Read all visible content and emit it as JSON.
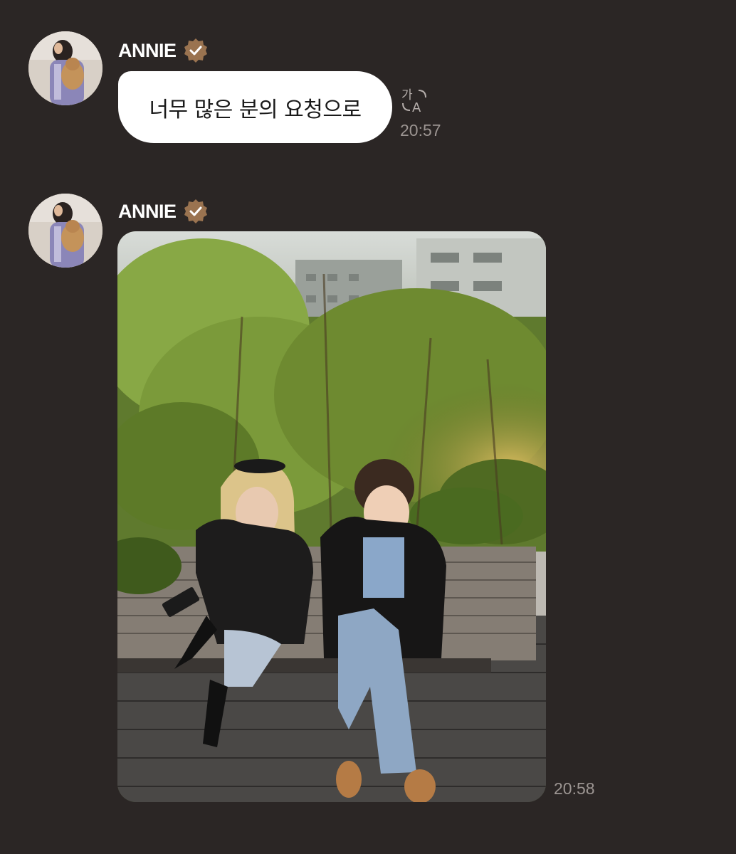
{
  "colors": {
    "background": "#2b2625",
    "bubble": "#ffffff",
    "verified_badge": "#9a7350",
    "timestamp": "#9c9592"
  },
  "messages": [
    {
      "sender": "ANNIE",
      "verified": true,
      "avatar_icon": "avatar-photo",
      "type": "text",
      "text": "너무 많은 분의 요청으로",
      "translate_icon": "translate-icon",
      "time": "20:57"
    },
    {
      "sender": "ANNIE",
      "verified": true,
      "avatar_icon": "avatar-photo",
      "type": "image",
      "image_icon": "photo-two-people-on-bench",
      "time": "20:58"
    }
  ]
}
